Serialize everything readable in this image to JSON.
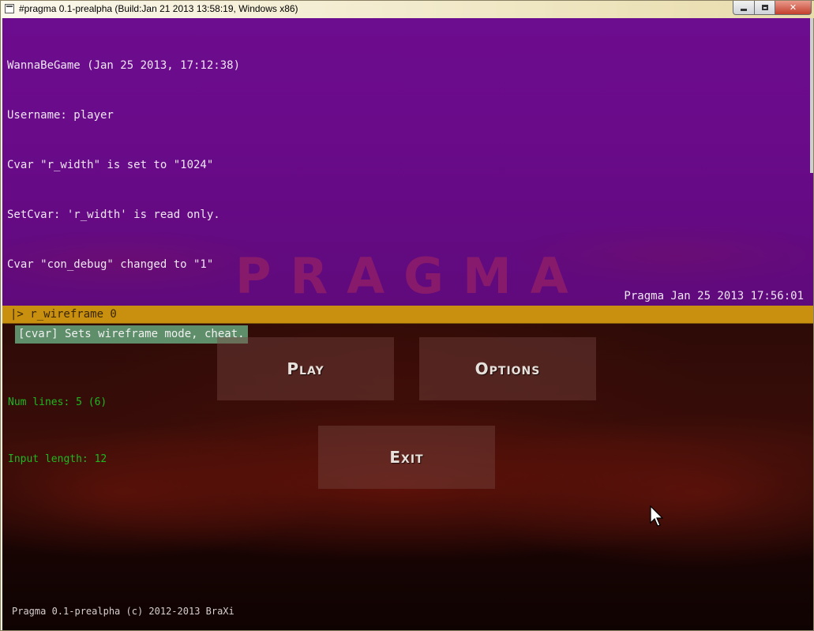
{
  "window": {
    "title": "#pragma 0.1-prealpha (Build:Jan 21 2013 13:58:19, Windows x86)",
    "icon": "app-icon"
  },
  "console": {
    "lines": [
      "WannaBeGame (Jan 25 2013, 17:12:38)",
      "Username: player",
      "Cvar \"r_width\" is set to \"1024\"",
      "SetCvar: 'r_width' is read only.",
      "Cvar \"con_debug\" changed to \"1\""
    ],
    "version_stamp": "Pragma Jan 25 2013 17:56:01",
    "logo_text": "PRAGMA",
    "input_text": "|> r_wireframe 0",
    "hint": "[cvar] Sets wireframe mode, cheat.",
    "debug": {
      "num_lines": "Num lines: 5 (6)",
      "input_length": "Input length: 12"
    },
    "colors": {
      "background": "#6a0b8a",
      "input_bar": "#c8900e",
      "hint_bg": "#5f8e6a",
      "debug_text": "#1fb81f"
    }
  },
  "menu": {
    "play_label": "Play",
    "options_label": "Options",
    "exit_label": "Exit"
  },
  "footer": {
    "text": "Pragma 0.1-prealpha (c) 2012-2013 BraXi"
  }
}
